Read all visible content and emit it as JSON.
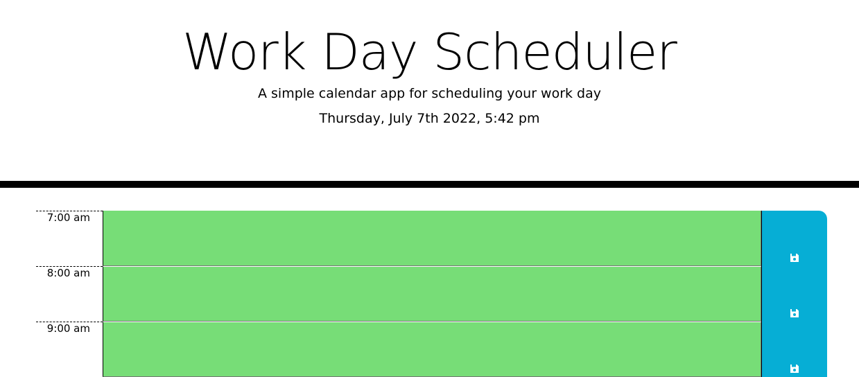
{
  "header": {
    "title": "Work Day Scheduler",
    "subtitle": "A simple calendar app for scheduling your work day",
    "current_date": "Thursday, July 7th 2022, 5:42 pm"
  },
  "colors": {
    "present": "#77dd77",
    "save_button": "#06aed5",
    "divider": "#000000"
  },
  "time_blocks": [
    {
      "hour_label": "7:00 am",
      "text": "",
      "state": "present",
      "save_icon": "floppy-disk-icon"
    },
    {
      "hour_label": "8:00 am",
      "text": "",
      "state": "present",
      "save_icon": "floppy-disk-icon"
    },
    {
      "hour_label": "9:00 am",
      "text": "",
      "state": "present",
      "save_icon": "floppy-disk-icon"
    }
  ]
}
